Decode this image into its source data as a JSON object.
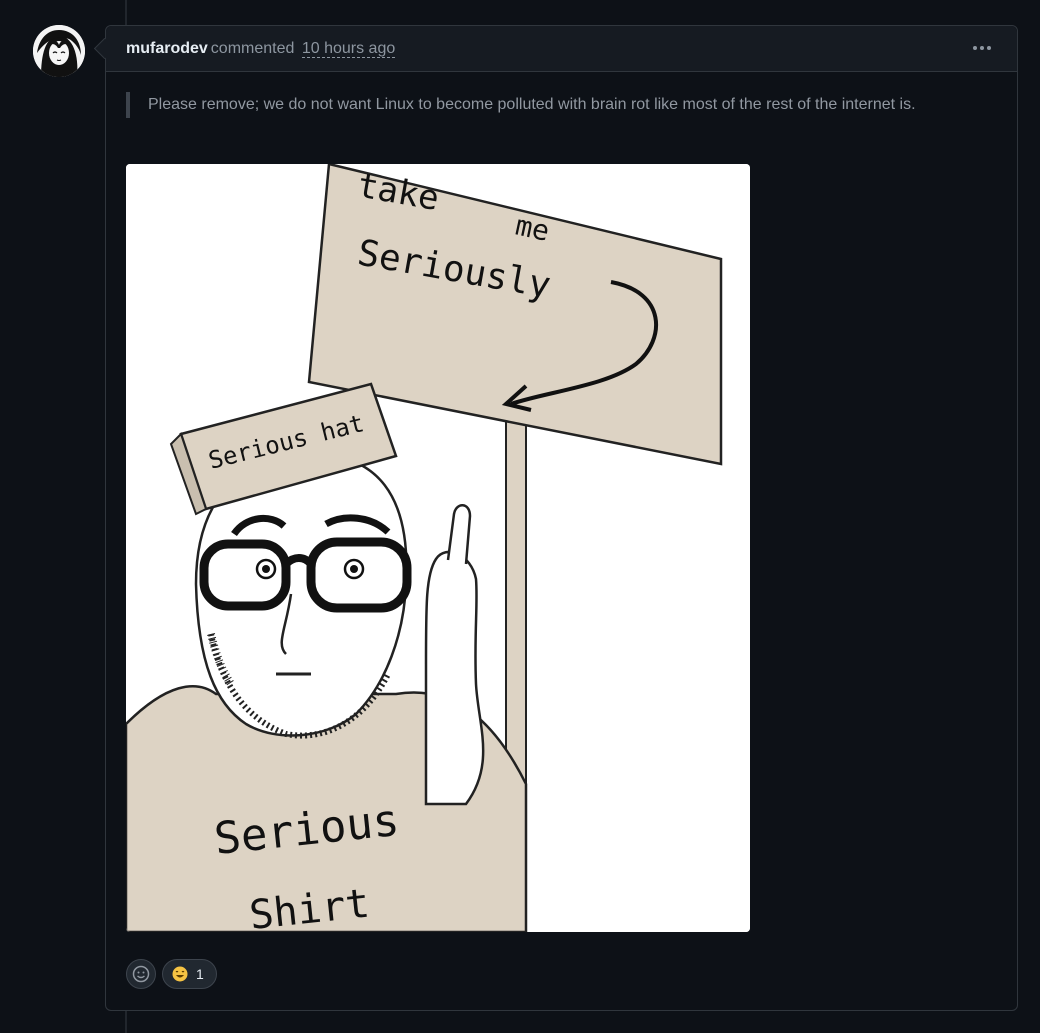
{
  "comment": {
    "author": "mufarodev",
    "action": "commented",
    "timestamp": "10 hours ago",
    "body": "Please remove; we do not want Linux to become polluted with brain rot like most of the rest of the internet is.",
    "image": {
      "sign_line1": "take",
      "sign_line2": "me",
      "sign_line3": "Seriously",
      "hat_text": "Serious hat",
      "shirt_line1": "Serious",
      "shirt_line2": "Shirt"
    },
    "reactions": [
      {
        "icon": "laugh-emoji-icon",
        "count": "1"
      }
    ]
  },
  "colors": {
    "background": "#0d1117",
    "header": "#161b22",
    "border": "#30363d",
    "muted_text": "#8d96a0",
    "cardboard": "#ddd3c4"
  }
}
